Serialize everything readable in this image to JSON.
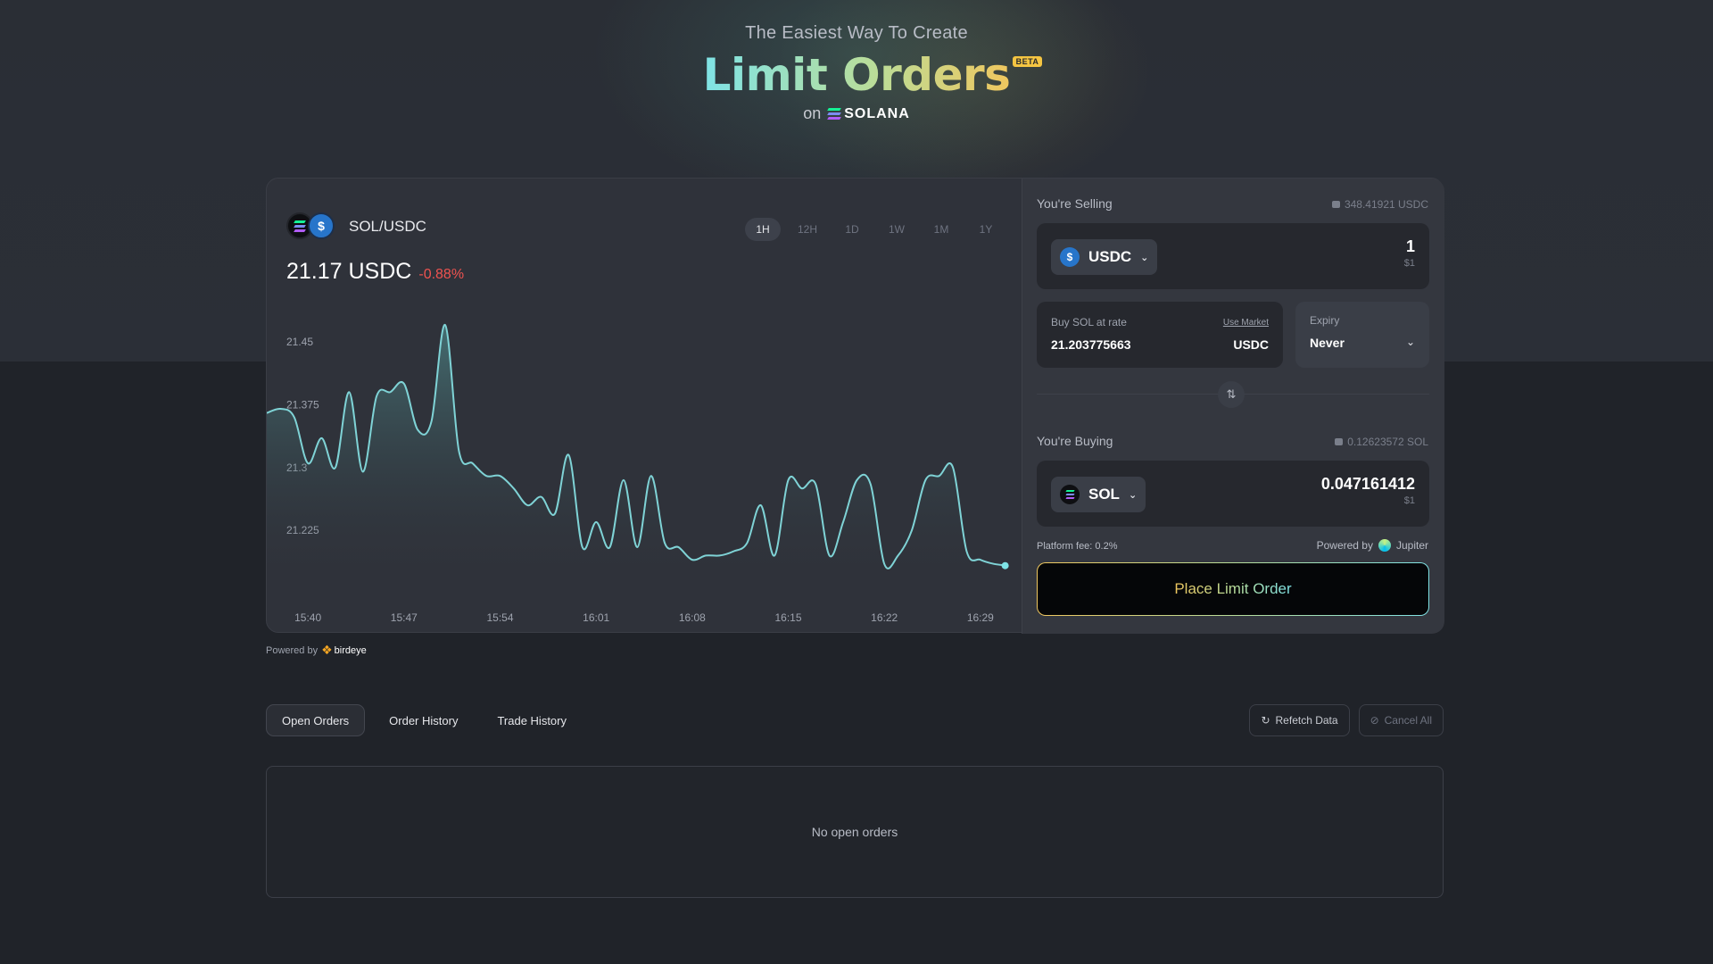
{
  "hero": {
    "tagline": "The Easiest Way To Create",
    "title": "Limit Orders",
    "badge": "BETA",
    "on_text": "on",
    "chain_name": "SOLANA"
  },
  "chart": {
    "pair": "SOL/USDC",
    "price": "21.17 USDC",
    "change": "-0.88%",
    "timeframes": [
      "1H",
      "12H",
      "1D",
      "1W",
      "1M",
      "1Y"
    ],
    "active_timeframe": "1H",
    "colors": {
      "line": "#7fd3d6",
      "change": "#ef5350"
    }
  },
  "chart_data": {
    "type": "area",
    "title": "",
    "xlabel": "",
    "ylabel": "",
    "y_ticks": [
      "21.45",
      "21.375",
      "21.3",
      "21.225"
    ],
    "x_ticks": [
      "15:40",
      "15:47",
      "15:54",
      "16:01",
      "16:08",
      "16:15",
      "16:22",
      "16:29"
    ],
    "ylim": [
      21.155,
      21.485
    ],
    "xlim": [
      "15:37",
      "16:32"
    ],
    "x": [
      "15:37",
      "15:38",
      "15:39",
      "15:40",
      "15:41",
      "15:42",
      "15:43",
      "15:44",
      "15:45",
      "15:46",
      "15:47",
      "15:48",
      "15:49",
      "15:50",
      "15:51",
      "15:52",
      "15:53",
      "15:54",
      "15:55",
      "15:56",
      "15:57",
      "15:58",
      "15:59",
      "16:00",
      "16:01",
      "16:02",
      "16:03",
      "16:04",
      "16:05",
      "16:06",
      "16:07",
      "16:08",
      "16:09",
      "16:10",
      "16:11",
      "16:12",
      "16:13",
      "16:14",
      "16:15",
      "16:16",
      "16:17",
      "16:18",
      "16:19",
      "16:20",
      "16:21",
      "16:22",
      "16:23",
      "16:24",
      "16:25",
      "16:26",
      "16:27",
      "16:28",
      "16:29",
      "16:30",
      "16:31"
    ],
    "series": [
      {
        "values": [
          21.365,
          21.37,
          21.36,
          21.305,
          21.335,
          21.3,
          21.39,
          21.295,
          21.385,
          21.39,
          21.4,
          21.345,
          21.355,
          21.47,
          21.32,
          21.305,
          21.29,
          21.29,
          21.275,
          21.255,
          21.265,
          21.245,
          21.315,
          21.205,
          21.235,
          21.205,
          21.285,
          21.205,
          21.29,
          21.21,
          21.205,
          21.19,
          21.195,
          21.195,
          21.2,
          21.21,
          21.255,
          21.195,
          21.285,
          21.275,
          21.28,
          21.195,
          21.235,
          21.285,
          21.28,
          21.185,
          21.195,
          21.225,
          21.285,
          21.29,
          21.3,
          21.2,
          21.19,
          21.185,
          21.183
        ]
      }
    ]
  },
  "order": {
    "selling_label": "You're Selling",
    "selling_balance": "348.41921 USDC",
    "sell_token": "USDC",
    "sell_amount": "1",
    "sell_usd": "$1",
    "rate_label": "Buy SOL at rate",
    "use_market": "Use Market",
    "rate_value": "21.203775663",
    "rate_unit": "USDC",
    "expiry_label": "Expiry",
    "expiry_value": "Never",
    "buying_label": "You're Buying",
    "buying_balance": "0.12623572 SOL",
    "buy_token": "SOL",
    "buy_amount": "0.047161412",
    "buy_usd": "$1",
    "fee": "Platform fee: 0.2%",
    "powered_by": "Powered by",
    "aggregator": "Jupiter",
    "place_button": "Place Limit Order"
  },
  "chart_credit": {
    "powered_by": "Powered by",
    "provider": "birdeye"
  },
  "orders": {
    "tabs": [
      "Open Orders",
      "Order History",
      "Trade History"
    ],
    "active_tab": "Open Orders",
    "refetch": "Refetch Data",
    "cancel_all": "Cancel All",
    "empty_message": "No open orders"
  }
}
